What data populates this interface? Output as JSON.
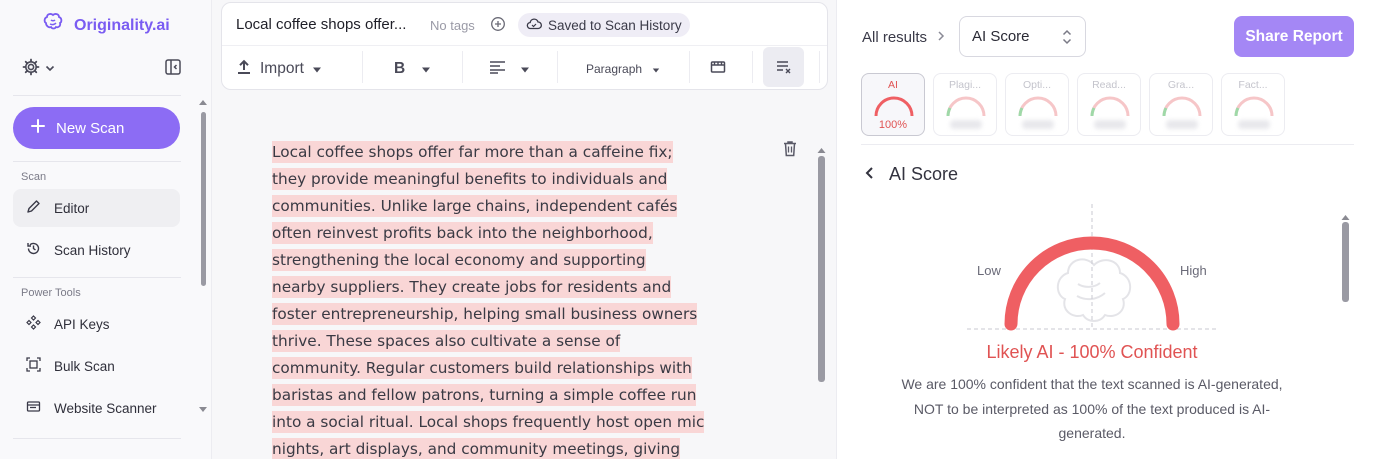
{
  "app": {
    "brand": "Originality.ai"
  },
  "sidebar": {
    "new_scan_label": "New Scan",
    "sections": [
      {
        "label": "Scan",
        "items": [
          {
            "label": "Editor",
            "icon": "pencil-icon",
            "active": true
          },
          {
            "label": "Scan History",
            "icon": "history-icon"
          }
        ]
      },
      {
        "label": "Power Tools",
        "items": [
          {
            "label": "API Keys",
            "icon": "api-icon"
          },
          {
            "label": "Bulk Scan",
            "icon": "bulk-scan-icon"
          },
          {
            "label": "Website Scanner",
            "icon": "website-icon"
          }
        ]
      }
    ]
  },
  "editor": {
    "doc_title": "Local coffee shops offer...",
    "no_tags": "No tags",
    "saved_badge": "Saved to Scan History",
    "toolbar": {
      "import_label": "Import",
      "bold_label": "B",
      "paragraph_label": "Paragraph"
    },
    "lines": [
      "Local coffee shops offer far more than a caffeine fix;",
      "they provide meaningful benefits to individuals and",
      "communities. Unlike large chains, independent cafés",
      "often reinvest profits back into the neighborhood,",
      "strengthening the local economy and supporting",
      "nearby suppliers. They create jobs for residents and",
      "foster entrepreneurship, helping small business owners",
      "thrive. These spaces also cultivate a sense of",
      "community. Regular customers build relationships with",
      "baristas and fellow patrons, turning a simple coffee run",
      "into a social ritual. Local shops frequently host open mic",
      "nights, art displays, and community meetings, giving"
    ],
    "highlight_color": "#f9d6d6"
  },
  "results": {
    "breadcrumb": "All results",
    "select_value": "AI Score",
    "share_label": "Share Report",
    "tabs": [
      {
        "label": "AI",
        "value": "100%",
        "active": true
      },
      {
        "label": "Plagi..."
      },
      {
        "label": "Opti..."
      },
      {
        "label": "Read..."
      },
      {
        "label": "Gra..."
      },
      {
        "label": "Fact..."
      }
    ],
    "section_title": "AI Score",
    "gauge": {
      "low_label": "Low",
      "high_label": "High",
      "score": 1.0
    },
    "verdict": "Likely AI - 100% Confident",
    "explanation": "We are 100% confident that the text scanned is AI-generated, NOT to be interpreted as 100% of the text produced is AI-generated.",
    "accent_color": "#e05353"
  },
  "colors": {
    "brand": "#8c6cf4",
    "share": "#a487f5",
    "ai_red": "#ef5f63"
  }
}
